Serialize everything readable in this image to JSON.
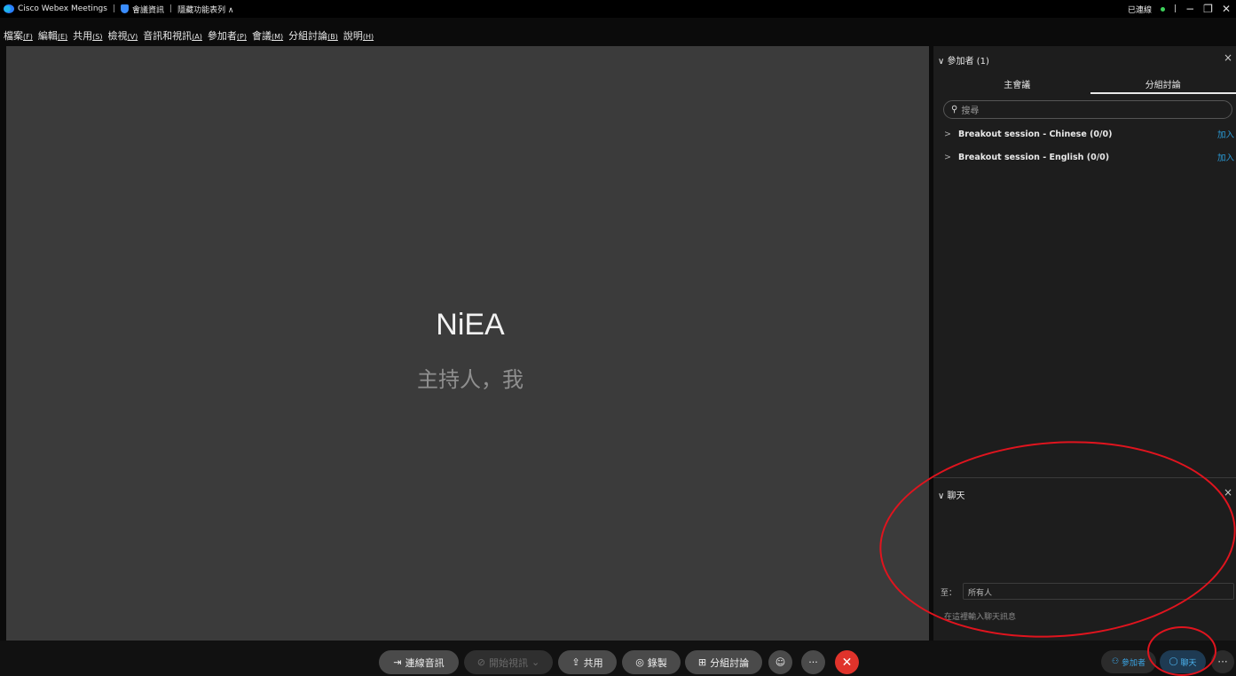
{
  "titlebar": {
    "app_name": "Cisco Webex Meetings",
    "sep1": "|",
    "meeting_info": "會議資訊",
    "sep2": "|",
    "hide_menu": "隱藏功能表列 ∧",
    "status": "已連線",
    "sep3": "|",
    "minimize": "−",
    "restore": "❐",
    "close": "✕"
  },
  "menubar": {
    "items": [
      {
        "label": "檔案",
        "key": "(F)"
      },
      {
        "label": "編輯",
        "key": "(E)"
      },
      {
        "label": "共用",
        "key": "(S)"
      },
      {
        "label": "檢視",
        "key": "(V)"
      },
      {
        "label": "音訊和視訊",
        "key": "(A)"
      },
      {
        "label": "參加者",
        "key": "(P)"
      },
      {
        "label": "會議",
        "key": "(M)"
      },
      {
        "label": "分組討論",
        "key": "(B)"
      },
      {
        "label": "說明",
        "key": "(H)"
      }
    ]
  },
  "stage": {
    "host_name": "NiEA",
    "host_role": "主持人，我"
  },
  "participants_panel": {
    "title": "∨ 參加者 (1)",
    "close": "×",
    "tabs": [
      "主會議",
      "分組討論"
    ],
    "search_placeholder": "搜尋",
    "sessions": [
      {
        "name": "Breakout session - Chinese (0/0)",
        "action": "加入"
      },
      {
        "name": "Breakout session - English (0/0)",
        "action": "加入"
      }
    ]
  },
  "chat_panel": {
    "title": "∨ 聊天",
    "close": "×",
    "to_label": "至：",
    "to_value": "所有人",
    "input_placeholder": "在這裡輸入聊天訊息"
  },
  "controls": {
    "audio": "連線音訊",
    "video": "開始視訊",
    "share": "共用",
    "record": "錄製",
    "breakout": "分組討論",
    "reactions_icon": "☺",
    "more": "···",
    "end": "✕",
    "participants_btn": "參加者",
    "chat_btn": "聊天",
    "more_right": "···"
  },
  "colors": {
    "accent": "#2a9bd8",
    "end_call": "#e0332b",
    "annotation": "#e0141e",
    "connected": "#3dd15b"
  }
}
